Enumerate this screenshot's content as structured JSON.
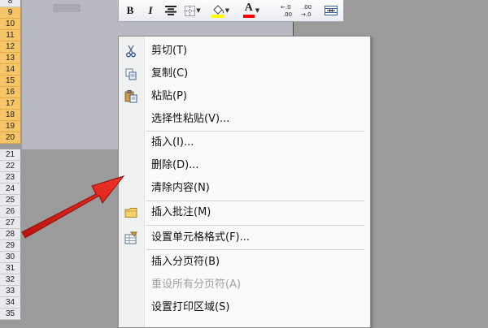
{
  "row_headers": [
    "8",
    "9",
    "10",
    "11",
    "12",
    "13",
    "14",
    "15",
    "16",
    "17",
    "18",
    "19",
    "20",
    "21",
    "22",
    "23",
    "24",
    "25",
    "26",
    "27",
    "28",
    "29",
    "30",
    "31",
    "32",
    "33",
    "34",
    "35"
  ],
  "selected_rows": [
    "9",
    "10",
    "11",
    "12",
    "13",
    "14",
    "15",
    "16",
    "17",
    "18",
    "19",
    "20"
  ],
  "toolbar": {
    "bold_label": "B",
    "italic_label": "I",
    "font_color_label": "A",
    "increase_decimal_label": "←.0\n.00",
    "decrease_decimal_label": ".00\n→.0",
    "fill_color": "#ffff00",
    "font_color": "#ff0000"
  },
  "menu": {
    "items": [
      {
        "label": "剪切(T)",
        "icon": "scissors-icon",
        "enabled": true
      },
      {
        "label": "复制(C)",
        "icon": "copy-icon",
        "enabled": true
      },
      {
        "label": "粘贴(P)",
        "icon": "paste-icon",
        "enabled": true
      },
      {
        "label": "选择性粘贴(V)...",
        "icon": "",
        "enabled": true
      },
      {
        "label": "插入(I)...",
        "icon": "",
        "enabled": true
      },
      {
        "label": "删除(D)...",
        "icon": "",
        "enabled": true
      },
      {
        "label": "清除内容(N)",
        "icon": "",
        "enabled": true
      },
      {
        "label": "插入批注(M)",
        "icon": "comment-icon",
        "enabled": true
      },
      {
        "label": "设置单元格格式(F)...",
        "icon": "format-cells-icon",
        "enabled": true
      },
      {
        "label": "插入分页符(B)",
        "icon": "",
        "enabled": true
      },
      {
        "label": "重设所有分页符(A)",
        "icon": "",
        "enabled": false
      },
      {
        "label": "设置打印区域(S)",
        "icon": "",
        "enabled": true
      }
    ]
  },
  "colors": {
    "arrow": "#e8231e",
    "selection_header": "#f5c567",
    "selection_area": "#b8b9c2"
  }
}
